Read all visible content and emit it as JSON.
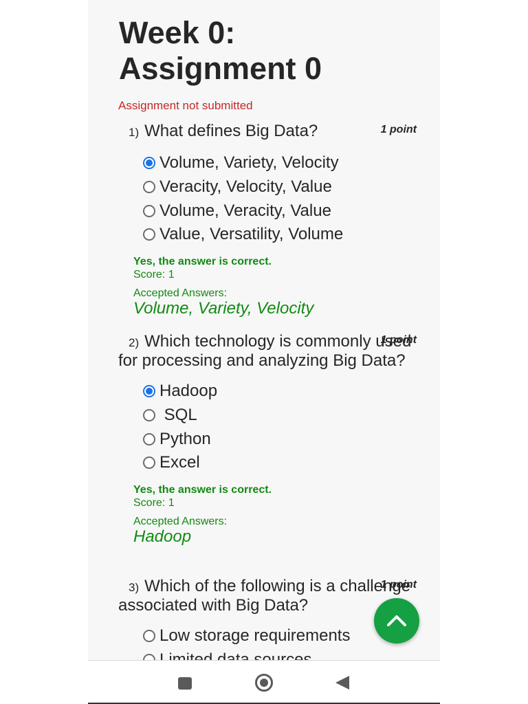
{
  "page": {
    "title_line1": "Week 0:",
    "title_line2": "Assignment 0",
    "status": "Assignment not submitted"
  },
  "questions": [
    {
      "number": "1)",
      "text": "What defines Big Data?",
      "points": "1 point",
      "options": [
        "Volume, Variety, Velocity",
        "Veracity, Velocity, Value",
        "Volume, Veracity, Value",
        "Value, Versatility, Volume"
      ],
      "selected": 0,
      "feedback": "Yes, the answer is correct.",
      "score": "Score: 1",
      "accepted_label": "Accepted Answers:",
      "accepted": "Volume, Variety, Velocity"
    },
    {
      "number": "2)",
      "text": "Which technology is commonly used for processing and analyzing Big Data?",
      "points": "1 point",
      "options": [
        "Hadoop",
        " SQL",
        "Python",
        "Excel"
      ],
      "selected": 0,
      "feedback": "Yes, the answer is correct.",
      "score": "Score: 1",
      "accepted_label": "Accepted Answers:",
      "accepted": "Hadoop"
    },
    {
      "number": "3)",
      "text": "Which of the following is a challenge associated with Big Data?",
      "points": "1 point",
      "options": [
        "Low storage requirements",
        "Limited data sources"
      ]
    }
  ],
  "fab": {
    "icon": "chevron-up-icon",
    "color": "#14a043"
  },
  "navbar": {
    "icons": [
      "recent-apps-icon",
      "home-icon",
      "back-icon"
    ]
  },
  "colors": {
    "accent": "#1a73e8",
    "correct": "#118a11",
    "not_submitted": "#c62828"
  }
}
